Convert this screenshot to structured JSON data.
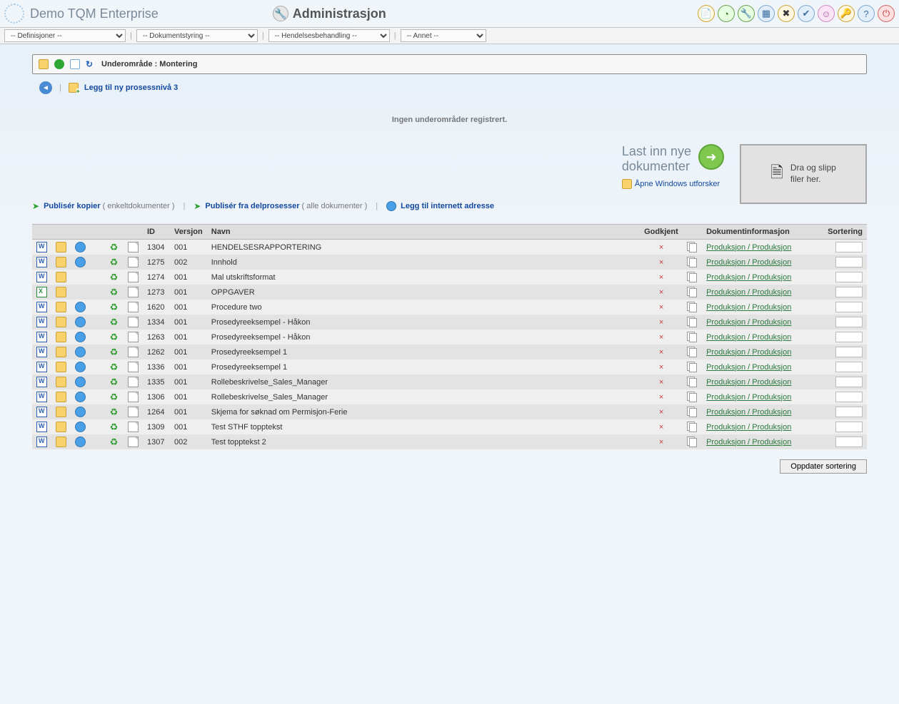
{
  "header": {
    "app_title": "Demo TQM Enterprise",
    "page_title": "Administrasjon"
  },
  "menubar": {
    "definisjoner": "-- Definisjoner --",
    "dokumentstyring": "-- Dokumentstyring --",
    "hendelsesbehandling": "-- Hendelsesbehandling --",
    "annet": "-- Annet --"
  },
  "breadcrumb": {
    "label": "Underområde : Montering"
  },
  "subaction": {
    "add_process": "Legg til ny prosessnivå 3"
  },
  "status": {
    "no_subareas": "Ingen underområder registrert."
  },
  "upload": {
    "load_docs_l1": "Last inn nye",
    "load_docs_l2": "dokumenter",
    "open_explorer": "Åpne Windows utforsker",
    "drop_l1": "Dra og slipp",
    "drop_l2": "filer her."
  },
  "publish": {
    "copies": "Publisér kopier",
    "copies_sub": "( enkeltdokumenter )",
    "subprocess": "Publisér fra delprosesser",
    "subprocess_sub": "( alle dokumenter )",
    "add_internet": "Legg til internett adresse"
  },
  "table": {
    "headers": {
      "id": "ID",
      "versjon": "Versjon",
      "navn": "Navn",
      "godkjent": "Godkjent",
      "info": "Dokumentinformasjon",
      "sortering": "Sortering"
    },
    "rows": [
      {
        "filetype": "word",
        "web": true,
        "id": "1304",
        "ver": "001",
        "name": "HENDELSESRAPPORTERING",
        "info": "Produksjon / Produksjon"
      },
      {
        "filetype": "word",
        "web": true,
        "id": "1275",
        "ver": "002",
        "name": "Innhold",
        "info": "Produksjon / Produksjon"
      },
      {
        "filetype": "word",
        "web": false,
        "id": "1274",
        "ver": "001",
        "name": "Mal utskriftsformat",
        "info": "Produksjon / Produksjon"
      },
      {
        "filetype": "excel",
        "web": false,
        "id": "1273",
        "ver": "001",
        "name": "OPPGAVER",
        "info": "Produksjon / Produksjon"
      },
      {
        "filetype": "word",
        "web": true,
        "id": "1620",
        "ver": "001",
        "name": "Procedure two",
        "info": "Produksjon / Produksjon"
      },
      {
        "filetype": "word",
        "web": true,
        "id": "1334",
        "ver": "001",
        "name": "Prosedyreeksempel - Håkon",
        "info": "Produksjon / Produksjon"
      },
      {
        "filetype": "word",
        "web": true,
        "id": "1263",
        "ver": "001",
        "name": "Prosedyreeksempel - Håkon",
        "info": "Produksjon / Produksjon"
      },
      {
        "filetype": "word",
        "web": true,
        "id": "1262",
        "ver": "001",
        "name": "Prosedyreeksempel 1",
        "info": "Produksjon / Produksjon"
      },
      {
        "filetype": "word",
        "web": true,
        "id": "1336",
        "ver": "001",
        "name": "Prosedyreeksempel 1",
        "info": "Produksjon / Produksjon"
      },
      {
        "filetype": "word",
        "web": true,
        "id": "1335",
        "ver": "001",
        "name": "Rollebeskrivelse_Sales_Manager",
        "info": "Produksjon / Produksjon"
      },
      {
        "filetype": "word",
        "web": true,
        "id": "1306",
        "ver": "001",
        "name": "Rollebeskrivelse_Sales_Manager",
        "info": "Produksjon / Produksjon"
      },
      {
        "filetype": "word",
        "web": true,
        "id": "1264",
        "ver": "001",
        "name": "Skjema for søknad om Permisjon-Ferie",
        "info": "Produksjon / Produksjon"
      },
      {
        "filetype": "word",
        "web": true,
        "id": "1309",
        "ver": "001",
        "name": "Test STHF topptekst",
        "info": "Produksjon / Produksjon"
      },
      {
        "filetype": "word",
        "web": true,
        "id": "1307",
        "ver": "002",
        "name": "Test topptekst 2",
        "info": "Produksjon / Produksjon"
      }
    ]
  },
  "buttons": {
    "update_sort": "Oppdater sortering"
  }
}
